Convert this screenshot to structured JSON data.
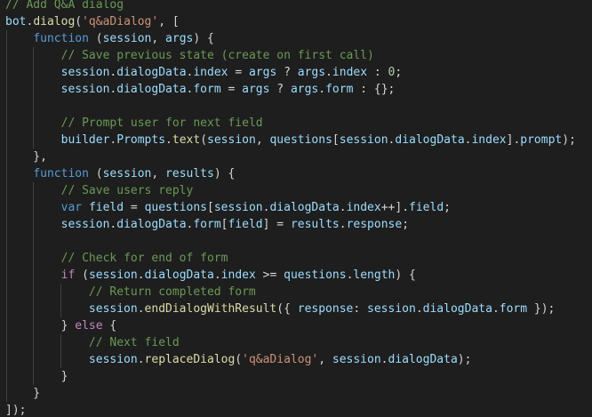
{
  "editor": {
    "language": "javascript",
    "theme": "dark",
    "background": "#1e1e1e",
    "colors": {
      "comment": "#6a9955",
      "keyword": "#569cd6",
      "control": "#c586c0",
      "function": "#dcdcaa",
      "string": "#ce9178",
      "number": "#b5cea8",
      "variable": "#9cdcfe",
      "punctuation": "#d4d4d4"
    },
    "lines": [
      [
        [
          "comment",
          "// Add Q&A dialog"
        ]
      ],
      [
        [
          "var",
          "bot"
        ],
        [
          "punc",
          "."
        ],
        [
          "func",
          "dialog"
        ],
        [
          "punc",
          "("
        ],
        [
          "string",
          "'q&aDialog'"
        ],
        [
          "punc",
          ", ["
        ]
      ],
      [
        [
          "punc",
          "    "
        ],
        [
          "keyword",
          "function"
        ],
        [
          "punc",
          " ("
        ],
        [
          "var",
          "session"
        ],
        [
          "punc",
          ", "
        ],
        [
          "var",
          "args"
        ],
        [
          "punc",
          ") {"
        ]
      ],
      [
        [
          "punc",
          "        "
        ],
        [
          "comment",
          "// Save previous state (create on first call)"
        ]
      ],
      [
        [
          "punc",
          "        "
        ],
        [
          "var",
          "session"
        ],
        [
          "punc",
          "."
        ],
        [
          "var",
          "dialogData"
        ],
        [
          "punc",
          "."
        ],
        [
          "var",
          "index"
        ],
        [
          "punc",
          " = "
        ],
        [
          "var",
          "args"
        ],
        [
          "punc",
          " ? "
        ],
        [
          "var",
          "args"
        ],
        [
          "punc",
          "."
        ],
        [
          "var",
          "index"
        ],
        [
          "punc",
          " : "
        ],
        [
          "number",
          "0"
        ],
        [
          "punc",
          ";"
        ]
      ],
      [
        [
          "punc",
          "        "
        ],
        [
          "var",
          "session"
        ],
        [
          "punc",
          "."
        ],
        [
          "var",
          "dialogData"
        ],
        [
          "punc",
          "."
        ],
        [
          "var",
          "form"
        ],
        [
          "punc",
          " = "
        ],
        [
          "var",
          "args"
        ],
        [
          "punc",
          " ? "
        ],
        [
          "var",
          "args"
        ],
        [
          "punc",
          "."
        ],
        [
          "var",
          "form"
        ],
        [
          "punc",
          " : {};"
        ]
      ],
      [],
      [
        [
          "punc",
          "        "
        ],
        [
          "comment",
          "// Prompt user for next field"
        ]
      ],
      [
        [
          "punc",
          "        "
        ],
        [
          "var",
          "builder"
        ],
        [
          "punc",
          "."
        ],
        [
          "var",
          "Prompts"
        ],
        [
          "punc",
          "."
        ],
        [
          "func",
          "text"
        ],
        [
          "punc",
          "("
        ],
        [
          "var",
          "session"
        ],
        [
          "punc",
          ", "
        ],
        [
          "var",
          "questions"
        ],
        [
          "punc",
          "["
        ],
        [
          "var",
          "session"
        ],
        [
          "punc",
          "."
        ],
        [
          "var",
          "dialogData"
        ],
        [
          "punc",
          "."
        ],
        [
          "var",
          "index"
        ],
        [
          "punc",
          "]."
        ],
        [
          "var",
          "prompt"
        ],
        [
          "punc",
          ");"
        ]
      ],
      [
        [
          "punc",
          "    },"
        ]
      ],
      [
        [
          "punc",
          "    "
        ],
        [
          "keyword",
          "function"
        ],
        [
          "punc",
          " ("
        ],
        [
          "var",
          "session"
        ],
        [
          "punc",
          ", "
        ],
        [
          "var",
          "results"
        ],
        [
          "punc",
          ") {"
        ]
      ],
      [
        [
          "punc",
          "        "
        ],
        [
          "comment",
          "// Save users reply"
        ]
      ],
      [
        [
          "punc",
          "        "
        ],
        [
          "keyword",
          "var"
        ],
        [
          "punc",
          " "
        ],
        [
          "var",
          "field"
        ],
        [
          "punc",
          " = "
        ],
        [
          "var",
          "questions"
        ],
        [
          "punc",
          "["
        ],
        [
          "var",
          "session"
        ],
        [
          "punc",
          "."
        ],
        [
          "var",
          "dialogData"
        ],
        [
          "punc",
          "."
        ],
        [
          "var",
          "index"
        ],
        [
          "punc",
          "++]."
        ],
        [
          "var",
          "field"
        ],
        [
          "punc",
          ";"
        ]
      ],
      [
        [
          "punc",
          "        "
        ],
        [
          "var",
          "session"
        ],
        [
          "punc",
          "."
        ],
        [
          "var",
          "dialogData"
        ],
        [
          "punc",
          "."
        ],
        [
          "var",
          "form"
        ],
        [
          "punc",
          "["
        ],
        [
          "var",
          "field"
        ],
        [
          "punc",
          "] = "
        ],
        [
          "var",
          "results"
        ],
        [
          "punc",
          "."
        ],
        [
          "var",
          "response"
        ],
        [
          "punc",
          ";"
        ]
      ],
      [],
      [
        [
          "punc",
          "        "
        ],
        [
          "comment",
          "// Check for end of form"
        ]
      ],
      [
        [
          "punc",
          "        "
        ],
        [
          "control",
          "if"
        ],
        [
          "punc",
          " ("
        ],
        [
          "var",
          "session"
        ],
        [
          "punc",
          "."
        ],
        [
          "var",
          "dialogData"
        ],
        [
          "punc",
          "."
        ],
        [
          "var",
          "index"
        ],
        [
          "punc",
          " >= "
        ],
        [
          "var",
          "questions"
        ],
        [
          "punc",
          "."
        ],
        [
          "var",
          "length"
        ],
        [
          "punc",
          ") {"
        ]
      ],
      [
        [
          "punc",
          "            "
        ],
        [
          "comment",
          "// Return completed form"
        ]
      ],
      [
        [
          "punc",
          "            "
        ],
        [
          "var",
          "session"
        ],
        [
          "punc",
          "."
        ],
        [
          "func",
          "endDialogWithResult"
        ],
        [
          "punc",
          "({ "
        ],
        [
          "var",
          "response"
        ],
        [
          "punc",
          ": "
        ],
        [
          "var",
          "session"
        ],
        [
          "punc",
          "."
        ],
        [
          "var",
          "dialogData"
        ],
        [
          "punc",
          "."
        ],
        [
          "var",
          "form"
        ],
        [
          "punc",
          " });"
        ]
      ],
      [
        [
          "punc",
          "        } "
        ],
        [
          "control",
          "else"
        ],
        [
          "punc",
          " {"
        ]
      ],
      [
        [
          "punc",
          "            "
        ],
        [
          "comment",
          "// Next field"
        ]
      ],
      [
        [
          "punc",
          "            "
        ],
        [
          "var",
          "session"
        ],
        [
          "punc",
          "."
        ],
        [
          "func",
          "replaceDialog"
        ],
        [
          "punc",
          "("
        ],
        [
          "string",
          "'q&aDialog'"
        ],
        [
          "punc",
          ", "
        ],
        [
          "var",
          "session"
        ],
        [
          "punc",
          "."
        ],
        [
          "var",
          "dialogData"
        ],
        [
          "punc",
          ");"
        ]
      ],
      [
        [
          "punc",
          "        }"
        ]
      ],
      [
        [
          "punc",
          "    }"
        ]
      ],
      [
        [
          "punc",
          "]);"
        ]
      ]
    ]
  }
}
